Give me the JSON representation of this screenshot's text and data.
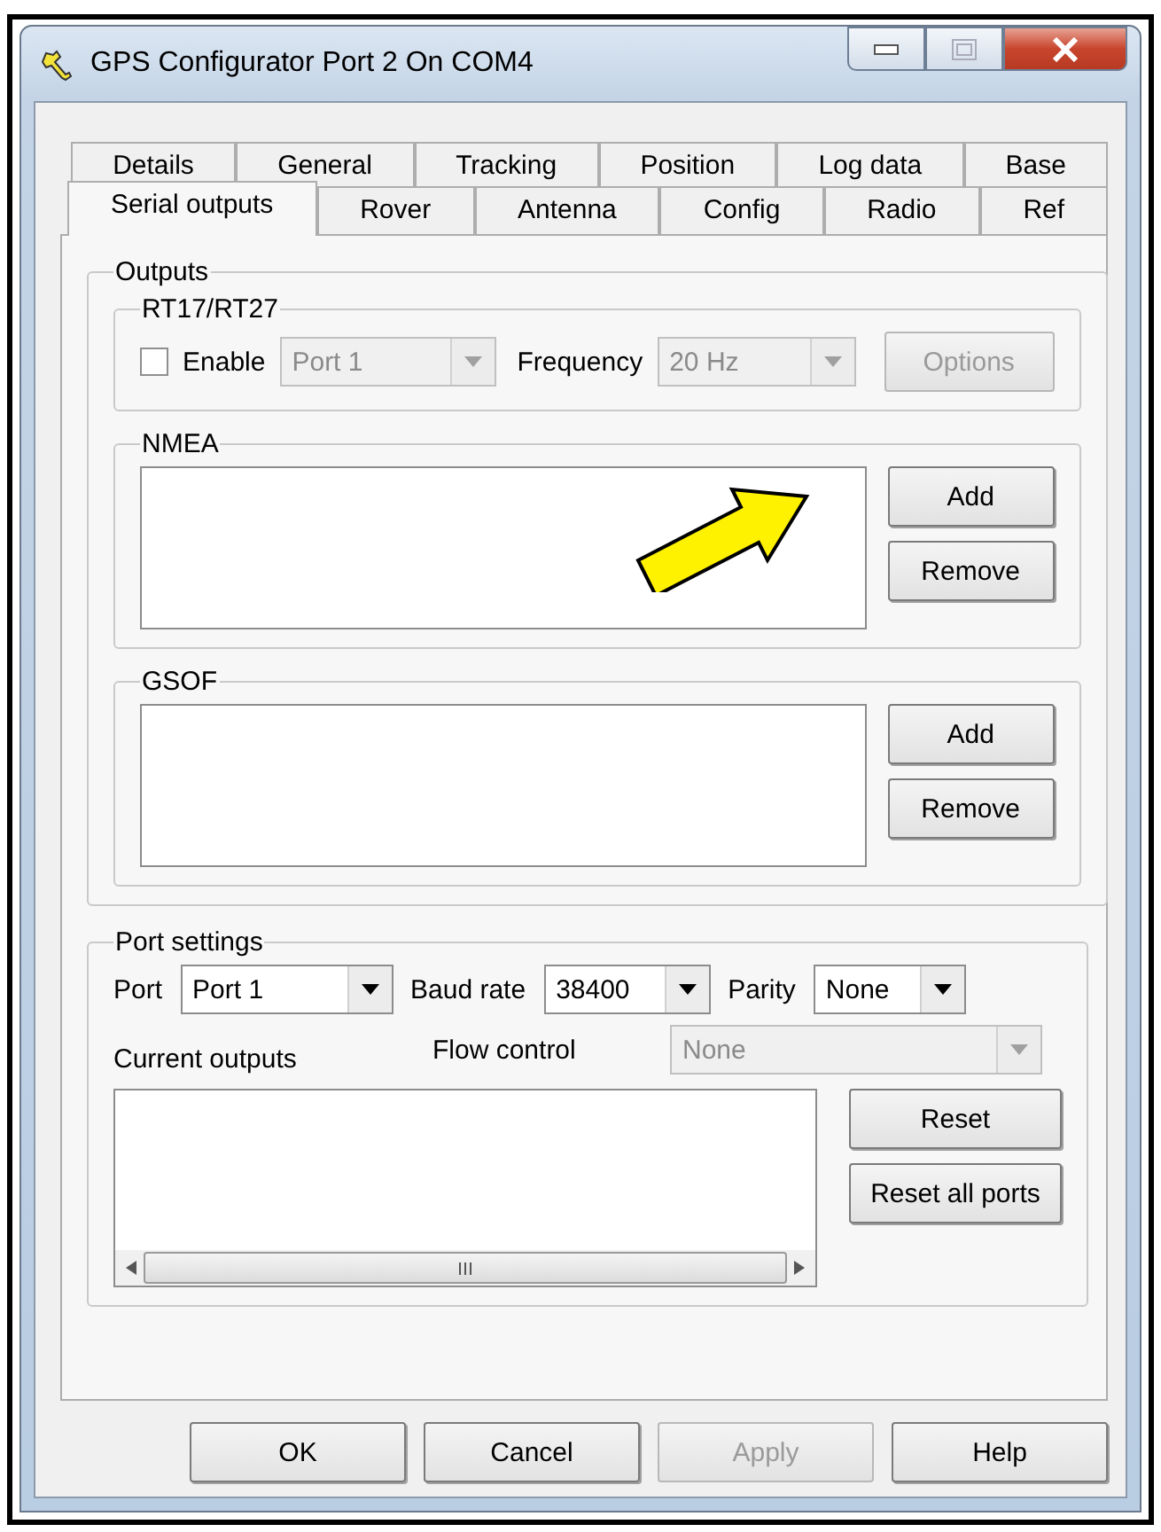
{
  "window": {
    "title": "GPS Configurator Port 2 On COM4"
  },
  "tabs": [
    [
      {
        "label": "Details",
        "selected": false
      },
      {
        "label": "General",
        "selected": false
      },
      {
        "label": "Tracking",
        "selected": false
      },
      {
        "label": "Position",
        "selected": false
      },
      {
        "label": "Log data",
        "selected": false
      },
      {
        "label": "Base",
        "selected": false
      }
    ],
    [
      {
        "label": "Serial outputs",
        "selected": true
      },
      {
        "label": "Rover",
        "selected": false
      },
      {
        "label": "Antenna",
        "selected": false
      },
      {
        "label": "Config",
        "selected": false
      },
      {
        "label": "Radio",
        "selected": false
      },
      {
        "label": "Ref",
        "selected": false
      }
    ]
  ],
  "outputs": {
    "title": "Outputs",
    "rt17": {
      "title": "RT17/RT27",
      "enable": {
        "label": "Enable",
        "checked": false
      },
      "port": {
        "value": "Port 1",
        "disabled": true
      },
      "frequency_label": "Frequency",
      "frequency": {
        "value": "20 Hz",
        "disabled": true
      },
      "options_button": {
        "label": "Options",
        "disabled": true
      }
    },
    "nmea": {
      "title": "NMEA",
      "buttons": [
        {
          "label": "Add",
          "disabled": false
        },
        {
          "label": "Remove",
          "disabled": false
        }
      ]
    },
    "gsof": {
      "title": "GSOF",
      "buttons": [
        {
          "label": "Add",
          "disabled": false
        },
        {
          "label": "Remove",
          "disabled": false
        }
      ]
    }
  },
  "port_settings": {
    "title": "Port settings",
    "port_label": "Port",
    "port": {
      "value": "Port 1",
      "disabled": false
    },
    "baud_label": "Baud rate",
    "baud": {
      "value": "38400",
      "disabled": false
    },
    "parity_label": "Parity",
    "parity": {
      "value": "None",
      "disabled": false
    },
    "flow_label": "Flow control",
    "flow": {
      "value": "None",
      "disabled": true
    },
    "current_outputs_label": "Current outputs",
    "buttons": [
      {
        "label": "Reset",
        "disabled": false
      },
      {
        "label": "Reset all ports",
        "disabled": false
      }
    ]
  },
  "buttons": [
    {
      "label": "OK",
      "disabled": false
    },
    {
      "label": "Cancel",
      "disabled": false
    },
    {
      "label": "Apply",
      "disabled": true
    },
    {
      "label": "Help",
      "disabled": false
    }
  ]
}
